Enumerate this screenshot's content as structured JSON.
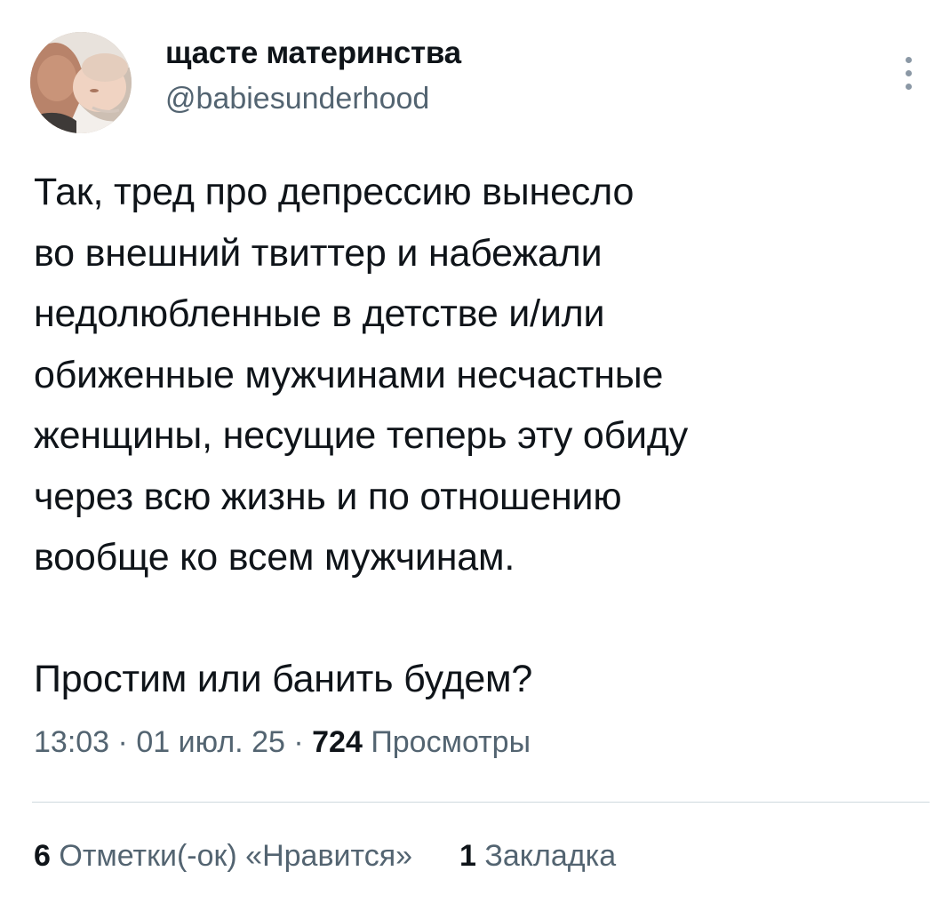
{
  "author": {
    "display_name": "щасте материнства",
    "handle": "@babiesunderhood",
    "avatar_icon": "profile-photo"
  },
  "more_icon": "more-options-icon",
  "tweet": {
    "lines": [
      "Так, тред про депрессию вынесло",
      "во внешний твиттер и набежали",
      "недолюбленные в детстве и/или",
      "обиженные мужчинами несчастные",
      "женщины, несущие теперь эту обиду",
      "через всю жизнь и по отношению",
      "вообще ко всем мужчинам."
    ],
    "question": "Простим или банить будем?"
  },
  "meta": {
    "time": "13:03",
    "separator": "·",
    "date": "01 июл. 25",
    "views_count": "724",
    "views_label": "Просмотры"
  },
  "stats": {
    "likes_count": "6",
    "likes_label": "Отметки(-ок) «Нравится»",
    "bookmarks_count": "1",
    "bookmarks_label": "Закладка"
  },
  "colors": {
    "text_primary": "#0f1419",
    "text_secondary": "#536471",
    "divider": "#cfd9de"
  }
}
